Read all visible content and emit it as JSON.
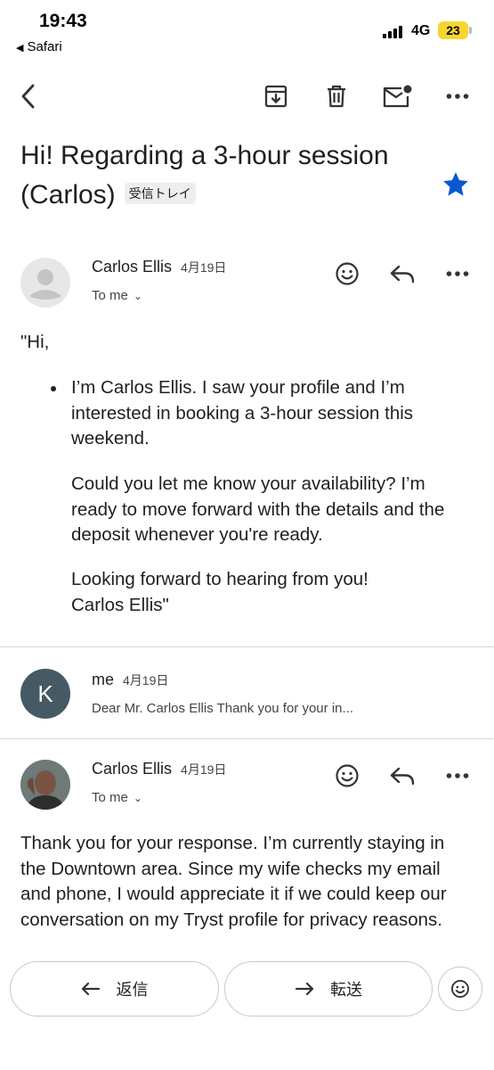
{
  "status_bar": {
    "time": "19:43",
    "back_app": "Safari",
    "network": "4G",
    "battery": "23"
  },
  "icons": {
    "back": "chevron-left-icon",
    "archive": "archive-icon",
    "delete": "trash-icon",
    "unread": "mark-unread-mail-icon",
    "more": "more-horizontal-icon",
    "star": "star-icon",
    "emoji": "smiley-icon",
    "reply": "reply-arrow-icon",
    "forward": "forward-arrow-icon"
  },
  "colors": {
    "star": "#0b57d0",
    "k_avatar": "#455a64",
    "battery": "#f6d62e"
  },
  "email": {
    "subject": "Hi! Regarding a 3-hour session (Carlos)",
    "label": "受信トレイ",
    "starred": true
  },
  "message1": {
    "sender": "Carlos Ellis",
    "date": "4月19日",
    "recipient": "To me",
    "greeting": "\"Hi,",
    "bullet": "I’m Carlos Ellis. I saw your profile and I’m interested in booking a 3-hour session this weekend.",
    "para1": "Could you let me know your availability? I’m ready to move forward with the details and the deposit whenever you're ready.",
    "para2_line1": "Looking forward to hearing from you!",
    "para2_line2": "Carlos Ellis\""
  },
  "message2": {
    "avatar_letter": "K",
    "sender": "me",
    "date": "4月19日",
    "snippet": "Dear Mr. Carlos Ellis Thank you for your in..."
  },
  "message3": {
    "sender": "Carlos Ellis",
    "date": "4月19日",
    "recipient": "To me",
    "body": "Thank you for your response. I’m currently staying in the Downtown area. Since my wife checks my email and phone, I would appreciate it if we could keep our conversation on my Tryst profile for privacy reasons."
  },
  "actions": {
    "reply": "返信",
    "forward": "転送"
  }
}
